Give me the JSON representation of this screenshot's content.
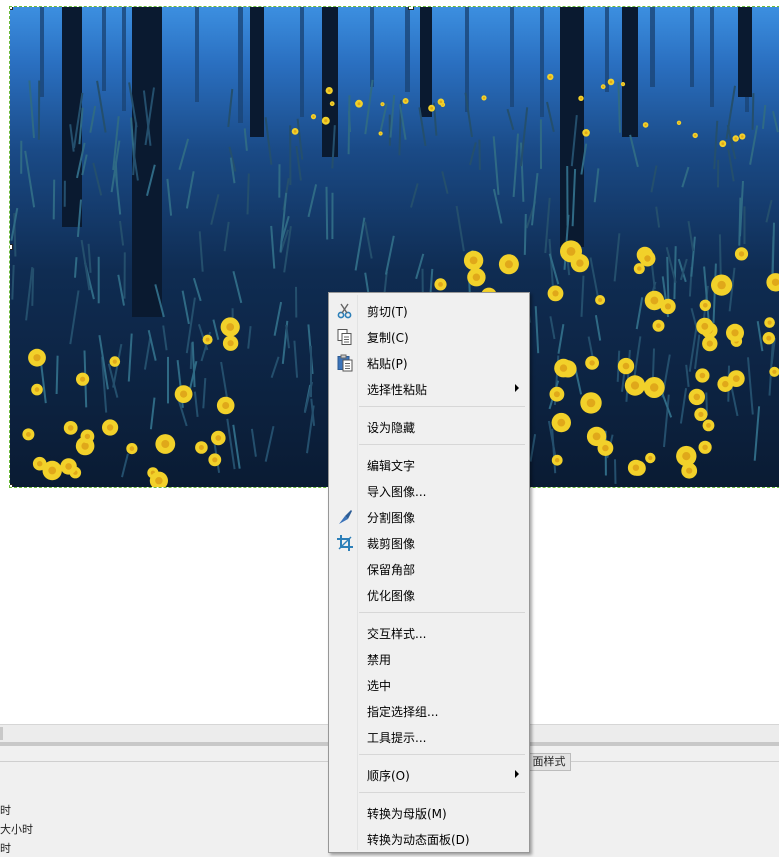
{
  "canvas": {
    "image_alt": "blue forest with yellow daffodils",
    "colors": {
      "sky": "#2f7fd6",
      "ground": "#0b1f38",
      "trunk": "#0a1a30",
      "flower": "#f2d12a"
    }
  },
  "bottom_panel": {
    "tab_label": "面样式",
    "lines": [
      "时",
      "大小时",
      "时"
    ]
  },
  "context_menu": {
    "items": [
      {
        "label": "剪切(T)",
        "icon": "scissors-icon",
        "submenu": false
      },
      {
        "label": "复制(C)",
        "icon": "copy-icon",
        "submenu": false
      },
      {
        "label": "粘贴(P)",
        "icon": "paste-icon",
        "submenu": false
      },
      {
        "label": "选择性粘贴",
        "icon": "",
        "submenu": true
      },
      {
        "label": "设为隐藏",
        "icon": "",
        "submenu": false
      },
      {
        "label": "编辑文字",
        "icon": "",
        "submenu": false
      },
      {
        "label": "导入图像...",
        "icon": "",
        "submenu": false
      },
      {
        "label": "分割图像",
        "icon": "slice-knife-icon",
        "submenu": false
      },
      {
        "label": "裁剪图像",
        "icon": "crop-icon",
        "submenu": false
      },
      {
        "label": "保留角部",
        "icon": "",
        "submenu": false
      },
      {
        "label": "优化图像",
        "icon": "",
        "submenu": false
      },
      {
        "label": "交互样式...",
        "icon": "",
        "submenu": false
      },
      {
        "label": "禁用",
        "icon": "",
        "submenu": false
      },
      {
        "label": "选中",
        "icon": "",
        "submenu": false
      },
      {
        "label": "指定选择组...",
        "icon": "",
        "submenu": false
      },
      {
        "label": "工具提示...",
        "icon": "",
        "submenu": false
      },
      {
        "label": "顺序(O)",
        "icon": "",
        "submenu": true
      },
      {
        "label": "转换为母版(M)",
        "icon": "",
        "submenu": false
      },
      {
        "label": "转换为动态面板(D)",
        "icon": "",
        "submenu": false
      }
    ]
  }
}
